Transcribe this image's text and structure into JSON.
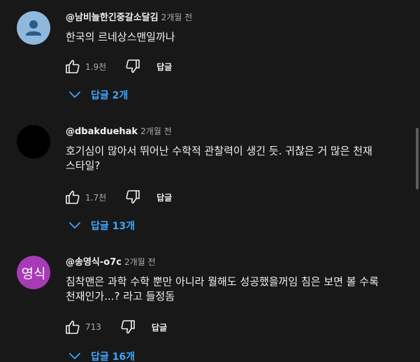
{
  "comments": [
    {
      "author": "@남비늘한긴중갈소달김",
      "time": "2개월 전",
      "text": "한국의 르네상스맨일까나",
      "likes": "1.9천",
      "reply_label": "답글",
      "replies_label": "답글 2개",
      "avatar_icon": "default-person-avatar"
    },
    {
      "author": "@dbakduehak",
      "time": "2개월 전",
      "text": "호기심이 많아서 뛰어난 수학적 관찰력이 생긴 듯. 귀찮은 거 많은 천재 스타일?",
      "likes": "1.7천",
      "reply_label": "답글",
      "replies_label": "답글 13개",
      "avatar_icon": "black-circle-avatar"
    },
    {
      "author": "@송영식-o7c",
      "time": "2개월 전",
      "text": "침착맨은 과학 수학 뿐만 아니라 뭘해도 성공했을꺼임 침은 보면 볼 수록 천재인가...? 라고 들정돔",
      "likes": "713",
      "reply_label": "답글",
      "replies_label": "답글 16개",
      "avatar_initials": "영식",
      "avatar_color": "#a73ab5"
    }
  ],
  "colors": {
    "background": "#181818",
    "link_blue": "#3ea6ff",
    "muted_text": "#aaaaaa"
  }
}
